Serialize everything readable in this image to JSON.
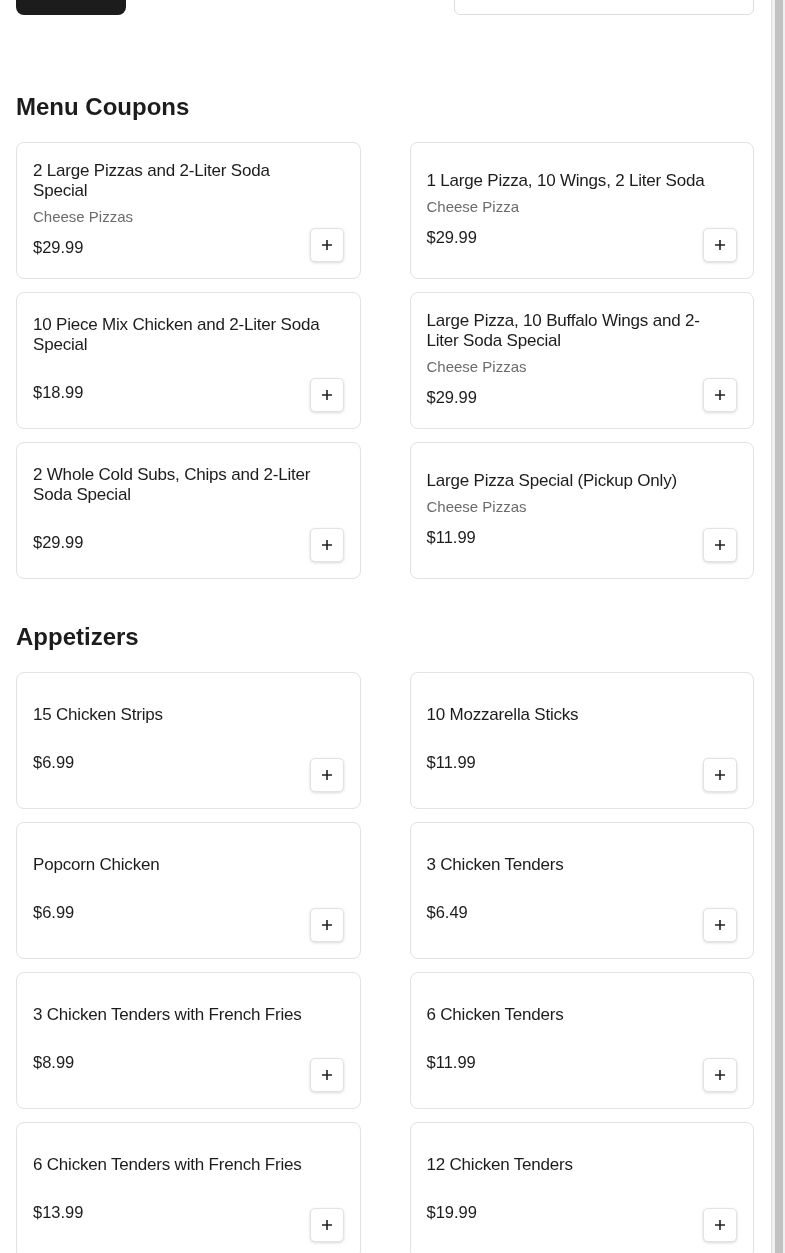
{
  "sections": [
    {
      "title": "Menu Coupons",
      "items": [
        {
          "name": "2 Large Pizzas and 2-Liter Soda Special",
          "category": "Cheese Pizzas",
          "price": "$29.99"
        },
        {
          "name": "1 Large Pizza, 10 Wings, 2 Liter Soda",
          "category": "Cheese Pizza",
          "price": "$29.99"
        },
        {
          "name": "10 Piece Mix Chicken and 2-Liter Soda Special",
          "price": "$18.99"
        },
        {
          "name": "Large Pizza, 10 Buffalo Wings and 2-Liter Soda Special",
          "category": "Cheese Pizzas",
          "price": "$29.99"
        },
        {
          "name": "2 Whole Cold Subs, Chips and 2-Liter Soda Special",
          "price": "$29.99"
        },
        {
          "name": "Large Pizza Special (Pickup Only)",
          "category": "Cheese Pizzas",
          "price": "$11.99"
        }
      ]
    },
    {
      "title": "Appetizers",
      "items": [
        {
          "name": "15 Chicken Strips",
          "price": "$6.99"
        },
        {
          "name": "10 Mozzarella Sticks",
          "price": "$11.99"
        },
        {
          "name": "Popcorn Chicken",
          "price": "$6.99"
        },
        {
          "name": "3 Chicken Tenders",
          "price": "$6.49"
        },
        {
          "name": "3 Chicken Tenders with French Fries",
          "price": "$8.99"
        },
        {
          "name": "6 Chicken Tenders",
          "price": "$11.99"
        },
        {
          "name": "6 Chicken Tenders with French Fries",
          "price": "$13.99"
        },
        {
          "name": "12 Chicken Tenders",
          "price": "$19.99"
        }
      ]
    }
  ]
}
